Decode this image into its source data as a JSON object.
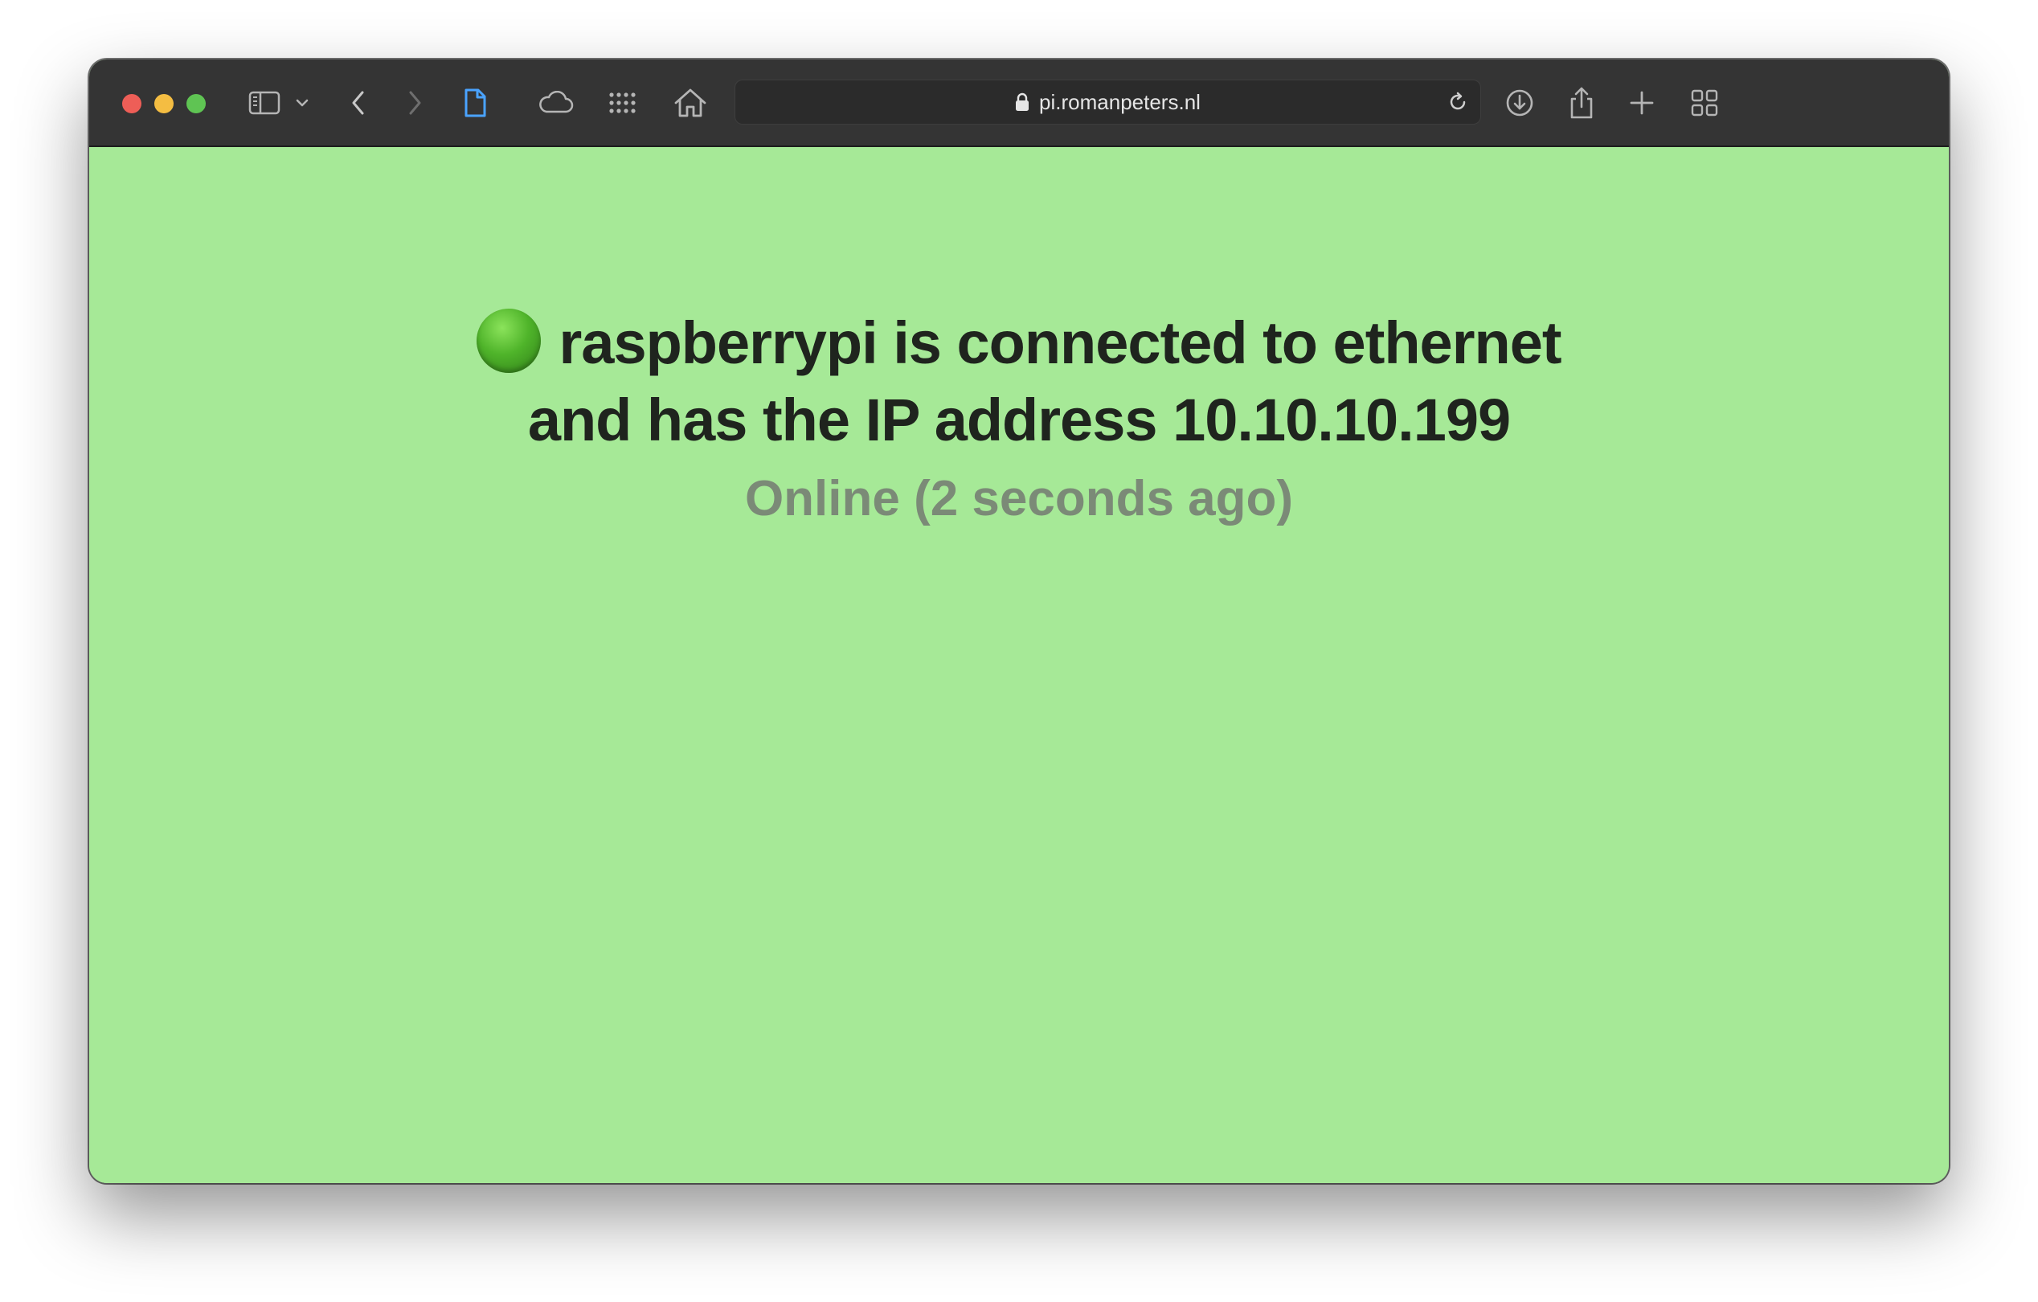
{
  "browser": {
    "url": "pi.romanpeters.nl",
    "toolbar": {
      "icons": [
        "sidebar-icon",
        "chevron-down-icon",
        "back-icon",
        "forward-icon",
        "page-icon",
        "cloud-icon",
        "grid-icon",
        "home-icon",
        "reload-icon",
        "download-icon",
        "share-icon",
        "new-tab-icon",
        "tab-overview-icon"
      ]
    }
  },
  "page": {
    "background_color": "#a6e997",
    "status_indicator_color": "#4fb42a",
    "headline_line1": "raspberrypi is connected to ethernet",
    "headline_line2": "and has the IP address 10.10.10.199",
    "status": "Online (2 seconds ago)"
  }
}
